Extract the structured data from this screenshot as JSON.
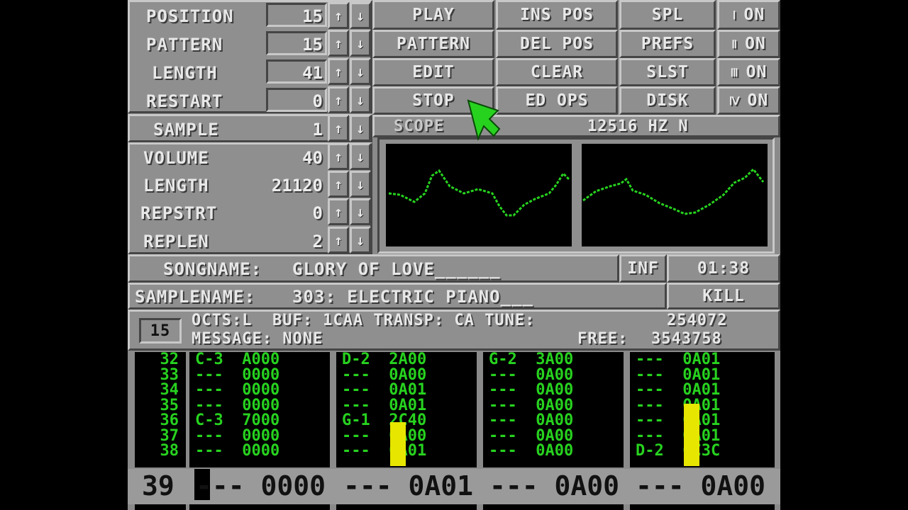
{
  "params": [
    {
      "label": "POSITION",
      "value": "15"
    },
    {
      "label": "PATTERN",
      "value": "15"
    },
    {
      "label": "LENGTH",
      "value": "41"
    },
    {
      "label": "RESTART",
      "value": "0"
    }
  ],
  "sample": {
    "label": "SAMPLE",
    "value": "1"
  },
  "sample_params": [
    {
      "label": "VOLUME",
      "value": "40"
    },
    {
      "label": "LENGTH",
      "value": "21120"
    },
    {
      "label": "REPSTRT",
      "value": "0"
    },
    {
      "label": "REPLEN",
      "value": "2"
    }
  ],
  "arrow_up": "↑",
  "arrow_down": "↓",
  "buttons": {
    "play": "PLAY",
    "pattern": "PATTERN",
    "edit": "EDIT",
    "stop": "STOP",
    "ins_pos": "INS POS",
    "del_pos": "DEL POS",
    "clear": "CLEAR",
    "ed_ops": "ED OPS",
    "spl": "SPL",
    "prefs": "PREFS",
    "slst": "SLST",
    "disk": "DISK"
  },
  "channels": [
    {
      "num": "Ⅰ",
      "state": "ON"
    },
    {
      "num": "Ⅱ",
      "state": "ON"
    },
    {
      "num": "Ⅲ",
      "state": "ON"
    },
    {
      "num": "Ⅳ",
      "state": "ON"
    }
  ],
  "scope": {
    "label": "SCOPE",
    "freq": "12516 HZ N"
  },
  "song": {
    "label": "SONGNAME:",
    "name": "GLORY OF LOVE______",
    "inf": "INF",
    "time": "01:38"
  },
  "samplename": {
    "label": "SAMPLENAME:",
    "name": "303: ELECTRIC PIANO___",
    "kill": "KILL"
  },
  "status": {
    "pattern_box": "15",
    "line1": "OCTS:L  BUF: 1CAA TRANSP: CA TUNE:",
    "tune": "254072",
    "line2": "MESSAGE: NONE",
    "free_label": "FREE:",
    "free": "3543758"
  },
  "rows": [
    "32",
    "33",
    "34",
    "35",
    "36",
    "37",
    "38"
  ],
  "tracks": [
    [
      "C-3  A000",
      "---  0000",
      "---  0000",
      "---  0000",
      "C-3  7000",
      "---  0000",
      "---  0000"
    ],
    [
      "D-2  2A00",
      "---  0A00",
      "---  0A01",
      "---  0A01",
      "G-1  2C40",
      "---  0A00",
      "---  0A01"
    ],
    [
      "G-2  3A00",
      "---  0A00",
      "---  0A00",
      "---  0A00",
      "---  0A00",
      "---  0A00",
      "---  0A00"
    ],
    [
      "---  0A01",
      "---  0A01",
      "---  0A01",
      "---  0A01",
      "---  0A01",
      "---  0A01",
      "D-2  6C3C"
    ]
  ],
  "current_row": {
    "num": "39",
    "cells": [
      "--- 0000",
      "--- 0A01",
      "--- 0A00",
      "--- 0A00"
    ]
  },
  "colors": {
    "green": "#27d21f",
    "vu": "#e6e600",
    "panel": "#8f8f8f"
  }
}
